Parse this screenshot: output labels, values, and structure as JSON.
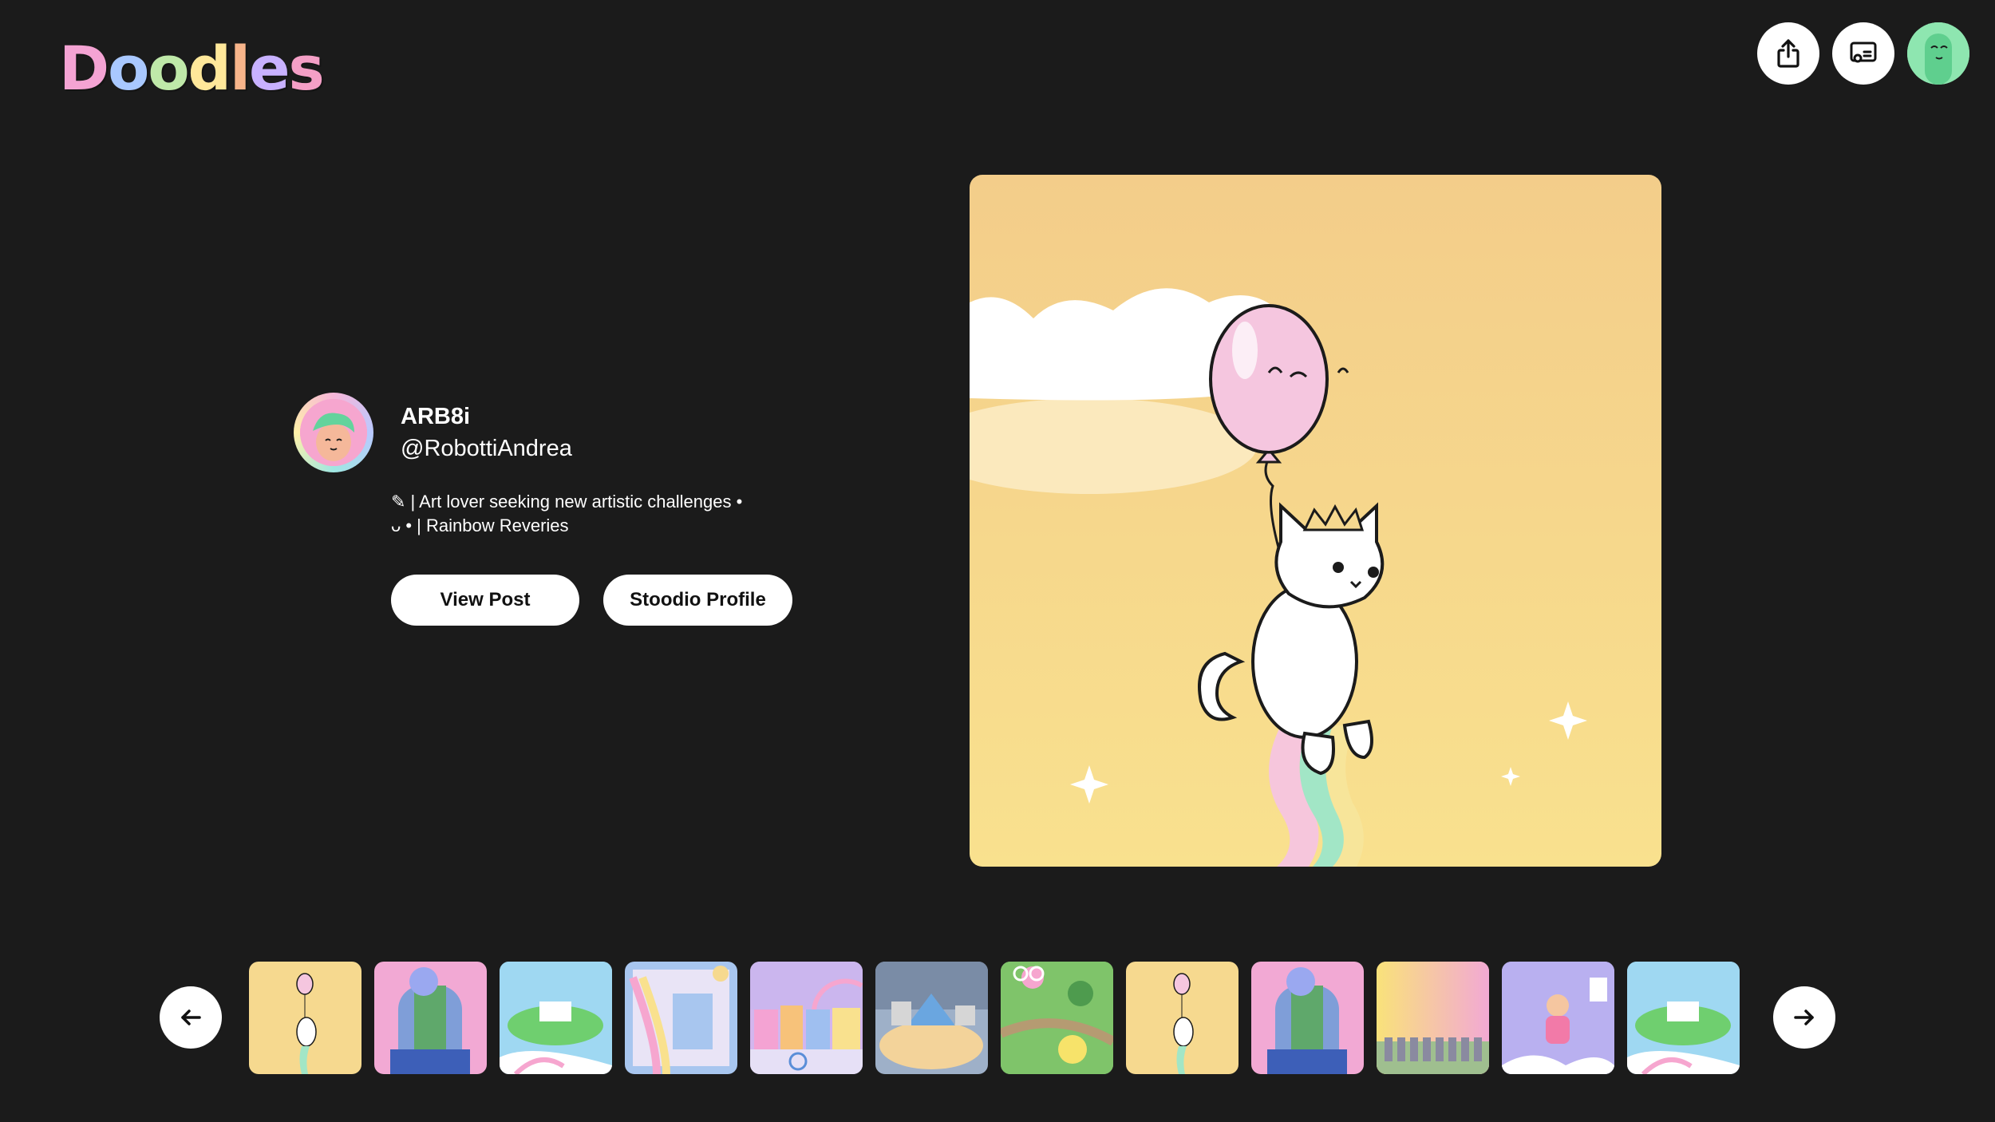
{
  "header": {
    "logo_text": "Doodles",
    "logo_colors": [
      "#f4a3d3",
      "#a9c8ff",
      "#bfe9a9",
      "#ffe89a",
      "#f7b48a",
      "#c8b1ff",
      "#f49fc6"
    ],
    "actions": [
      {
        "name": "share",
        "icon": "share-icon"
      },
      {
        "name": "cast",
        "icon": "cast-icon"
      },
      {
        "name": "user-avatar",
        "icon": "user-avatar"
      }
    ]
  },
  "profile": {
    "display_name": "ARB8i",
    "handle": "@RobottiAndrea",
    "bio_line1": "✎ | Art lover seeking new artistic challenges •",
    "bio_line2": "ᴗ • | Rainbow Reveries",
    "view_post_label": "View Post",
    "stoodio_profile_label": "Stoodio Profile"
  },
  "artwork": {
    "background_top": "#f4cf8c",
    "background_bottom": "#f9e08e",
    "balloon_color": "#f5c6df"
  },
  "gallery": {
    "prev_icon": "arrow-left-icon",
    "next_icon": "arrow-right-icon",
    "thumbnails": [
      {
        "name": "thumb-cat-balloon",
        "bg": "#f6d98f"
      },
      {
        "name": "thumb-split-face",
        "bg": "#f2a9d4"
      },
      {
        "name": "thumb-floating-island",
        "bg": "#9fd8f2"
      },
      {
        "name": "thumb-rainbow-room",
        "bg": "#a8c6ef"
      },
      {
        "name": "thumb-city-rainbow",
        "bg": "#d3b6ee"
      },
      {
        "name": "thumb-desk-scene",
        "bg": "#9eb0c8"
      },
      {
        "name": "thumb-forest-garden",
        "bg": "#8fca7a"
      },
      {
        "name": "thumb-cat-balloon-2",
        "bg": "#f6d98f"
      },
      {
        "name": "thumb-split-face-2",
        "bg": "#f2a9d4"
      },
      {
        "name": "thumb-gradient-figures",
        "bg": "#f7d58a"
      },
      {
        "name": "thumb-purple-sky",
        "bg": "#b9b0f0"
      },
      {
        "name": "thumb-floating-island-2",
        "bg": "#9fd8f2"
      }
    ]
  }
}
